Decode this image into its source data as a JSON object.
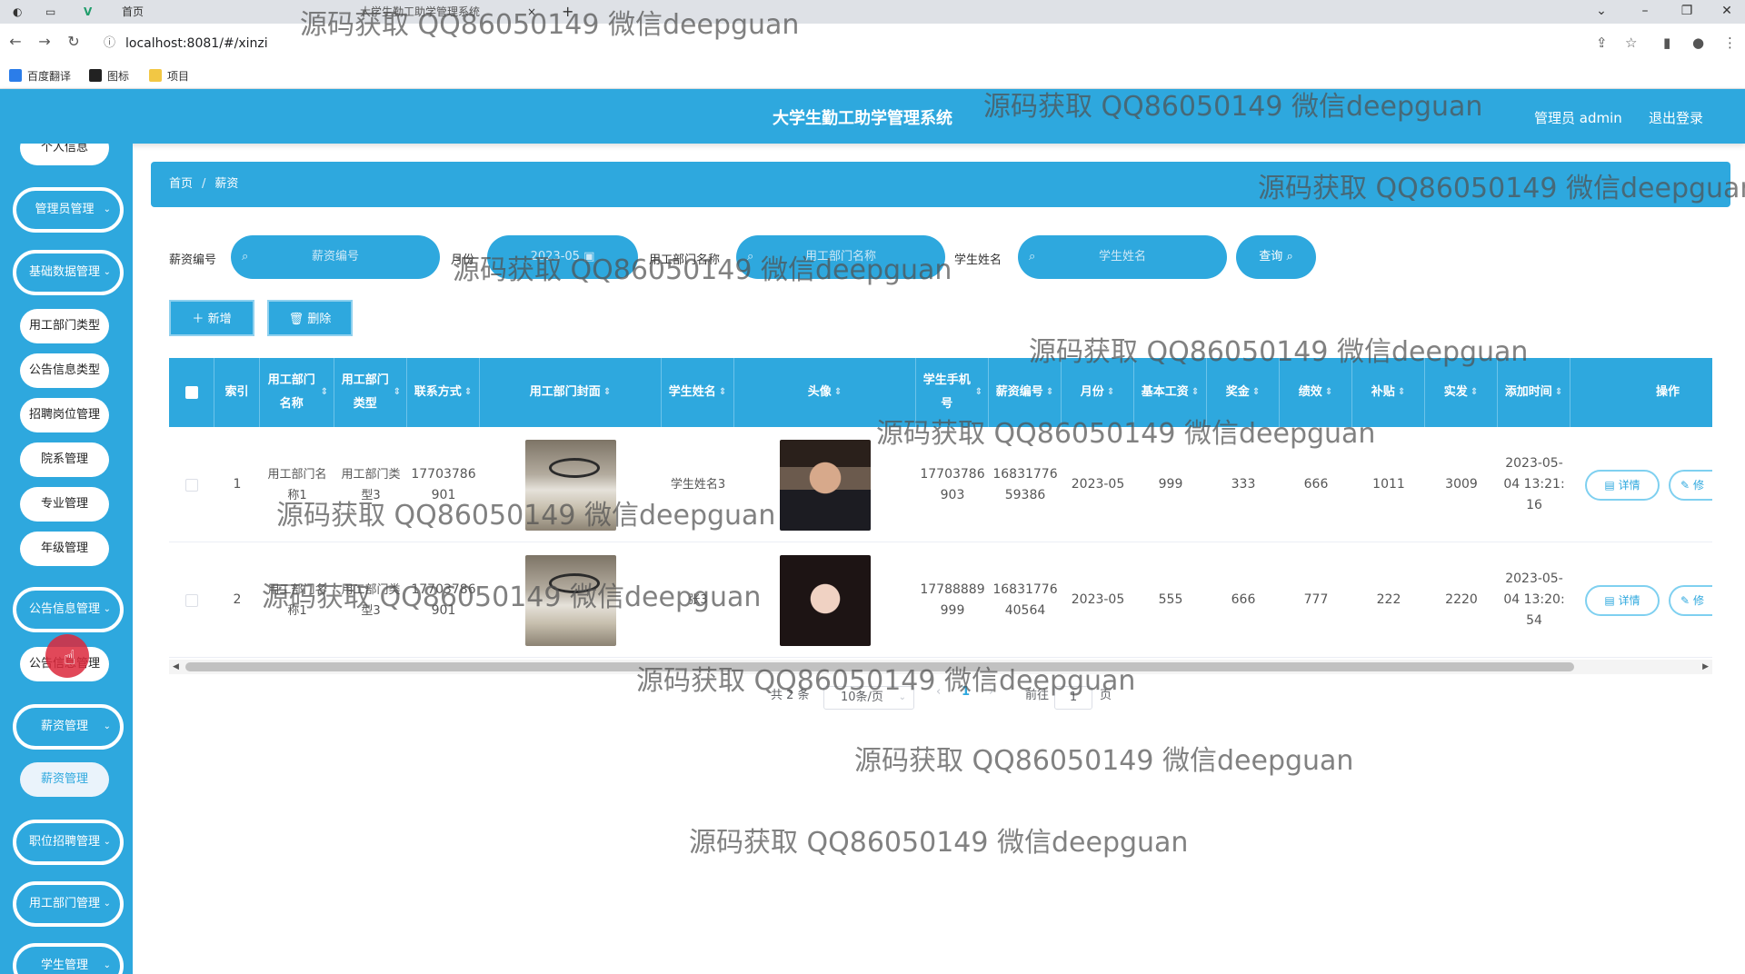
{
  "browser": {
    "tab_home": "首页",
    "tab_active": "大学生勤工助学管理系统",
    "tab_close": "×",
    "tab_new": "+",
    "url": "localhost:8081/#/xinzi",
    "bookmarks": [
      "百度翻译",
      "图标",
      "项目"
    ]
  },
  "header": {
    "title": "大学生勤工助学管理系统",
    "admin": "管理员 admin",
    "logout": "退出登录"
  },
  "sidebar": {
    "items": [
      {
        "label": "个人信息",
        "type": "sub"
      },
      {
        "label": "管理员管理",
        "type": "group"
      },
      {
        "label": "基础数据管理",
        "type": "group"
      },
      {
        "label": "用工部门类型",
        "type": "sub"
      },
      {
        "label": "公告信息类型",
        "type": "sub"
      },
      {
        "label": "招聘岗位管理",
        "type": "sub"
      },
      {
        "label": "院系管理",
        "type": "sub"
      },
      {
        "label": "专业管理",
        "type": "sub"
      },
      {
        "label": "年级管理",
        "type": "sub"
      },
      {
        "label": "公告信息管理",
        "type": "group"
      },
      {
        "label": "公告信息管理",
        "type": "sub"
      },
      {
        "label": "薪资管理",
        "type": "group"
      },
      {
        "label": "薪资管理",
        "type": "sub"
      },
      {
        "label": "职位招聘管理",
        "type": "group"
      },
      {
        "label": "用工部门管理",
        "type": "group"
      },
      {
        "label": "学生管理",
        "type": "group"
      }
    ]
  },
  "breadcrumb": {
    "home": "首页",
    "sep": "/",
    "current": "薪资"
  },
  "search": {
    "label_salary_no": "薪资编号",
    "ph_salary_no": "薪资编号",
    "label_month": "月份",
    "ph_month": "2023-05",
    "label_dept": "用工部门名称",
    "ph_dept": "用工部门名称",
    "label_student": "学生姓名",
    "ph_student": "学生姓名",
    "query_btn": "查询"
  },
  "actions": {
    "add": "新增",
    "delete": "删除"
  },
  "table": {
    "columns": [
      "索引",
      "用工部门名称",
      "用工部门类型",
      "联系方式",
      "用工部门封面",
      "学生姓名",
      "头像",
      "学生手机号",
      "薪资编号",
      "月份",
      "基本工资",
      "奖金",
      "绩效",
      "补贴",
      "实发",
      "添加时间",
      "操作"
    ],
    "rows": [
      {
        "index": "1",
        "dept": "用工部门名称1",
        "dept_type": "用工部门类型3",
        "phone": "17703786901",
        "student": "学生姓名3",
        "student_phone": "17703786903",
        "salary_no": "1683177659386",
        "month": "2023-05",
        "base": "999",
        "bonus": "333",
        "perf": "666",
        "allow": "1011",
        "net": "3009",
        "time": "2023-05-04 13:21:16"
      },
      {
        "index": "2",
        "dept": "用工部门名称1",
        "dept_type": "用工部门类型3",
        "phone": "17703786901",
        "student": "张3",
        "student_phone": "17788889999",
        "salary_no": "1683177640564",
        "month": "2023-05",
        "base": "555",
        "bonus": "666",
        "perf": "777",
        "allow": "222",
        "net": "2220",
        "time": "2023-05-04 13:20:54"
      }
    ],
    "detail_btn": "详情",
    "edit_btn": "修"
  },
  "pagination": {
    "total": "共 2 条",
    "page_size": "10条/页",
    "current": "1",
    "goto": "前往",
    "page_input": "1",
    "page_unit": "页"
  },
  "watermark": "源码获取 QQ86050149 微信deepguan",
  "colors": {
    "primary": "#2ea8de",
    "chrome": "#dee1e6",
    "cursor": "#dc283c"
  }
}
